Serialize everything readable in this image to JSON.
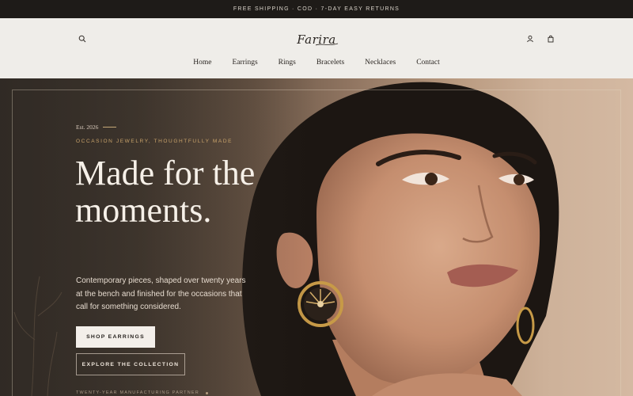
{
  "announcement": "FREE SHIPPING · COD · 7-DAY EASY RETURNS",
  "brand": {
    "logo_text": "Farira"
  },
  "header": {
    "left_icons": [
      "search-icon"
    ],
    "right_icons": [
      "account-icon",
      "cart-icon"
    ]
  },
  "nav": {
    "items": [
      {
        "label": "Home"
      },
      {
        "label": "Earrings"
      },
      {
        "label": "Rings"
      },
      {
        "label": "Bracelets"
      },
      {
        "label": "Necklaces"
      },
      {
        "label": "Contact"
      }
    ]
  },
  "hero": {
    "est": "Est. 2026",
    "eyebrow": "OCCASION JEWELRY, THOUGHTFULLY MADE",
    "headline": "Made for the moments.",
    "subtext": "Contemporary pieces, shaped over twenty years at the bench and finished for the occasions that call for something considered.",
    "primary_cta": "SHOP EARRINGS",
    "secondary_cta": "EXPLORE THE COLLECTION",
    "partner_text": "TWENTY-YEAR MANUFACTURING PARTNER"
  },
  "colors": {
    "accent_gold": "#c9a36b",
    "header_bg": "#efede9",
    "announce_bg": "#1e1b18"
  }
}
